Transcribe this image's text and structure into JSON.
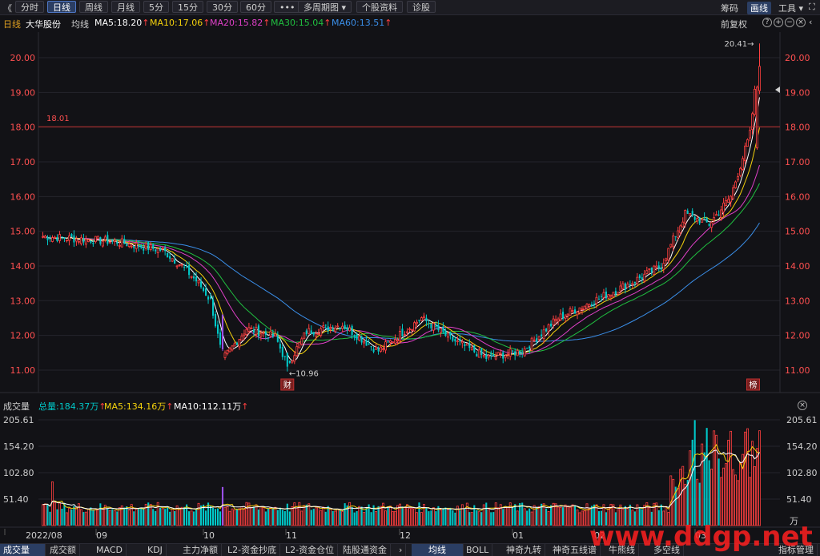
{
  "toolbar": {
    "back_label": "《",
    "periods": [
      "分时",
      "日线",
      "周线",
      "月线",
      "5分",
      "15分",
      "30分",
      "60分"
    ],
    "active_period": "日线",
    "more_label": "•••",
    "multi_period_label": "多周期图",
    "stock_info_label": "个股资料",
    "diagnose_label": "诊股",
    "right": {
      "chips_label": "筹码",
      "draw_label": "画线",
      "tools_label": "工具"
    }
  },
  "price_legend": {
    "period": "日线",
    "stock_name": "大华股份",
    "avg_label": "均线",
    "ma5": "MA5:18.20",
    "ma10": "MA10:17.06",
    "ma20": "MA20:15.82",
    "ma30": "MA30:15.04",
    "ma60": "MA60:13.51",
    "adjust_label": "前复权"
  },
  "volume_legend": {
    "title": "成交量",
    "total": "总量:184.37万",
    "ma5": "MA5:134.16万",
    "ma10": "MA10:112.11万"
  },
  "colors": {
    "up": "#ff4040",
    "down": "#00c8c8",
    "ma5": "#ffffff",
    "ma10": "#f5d20c",
    "ma20": "#e040c8",
    "ma30": "#20c040",
    "ma60": "#3a8ee8",
    "special": "#9a50e8",
    "bg": "#121216"
  },
  "chart_data": {
    "type": "candlestick",
    "price_ticks": [
      "20.00",
      "19.00",
      "18.00",
      "17.00",
      "16.00",
      "15.00",
      "14.00",
      "13.00",
      "12.00",
      "11.00"
    ],
    "volume_ticks": [
      "205.61",
      "154.20",
      "102.80",
      "51.40"
    ],
    "volume_unit": "万",
    "month_labels": [
      "2022/08",
      "09",
      "10",
      "11",
      "12",
      "01",
      "02",
      "03"
    ],
    "reference_line": {
      "value": 18.01,
      "label": "18.01"
    },
    "high_annotation": {
      "value": 20.41,
      "label": "20.41→"
    },
    "low_annotation": {
      "value": 10.96,
      "label": "←10.96"
    },
    "markers": [
      {
        "label": "财"
      },
      {
        "label": "榜"
      }
    ],
    "ylim": [
      10.7,
      20.9
    ],
    "candles_note": "OHLC values read approximately from chart",
    "key_points": [
      {
        "x": 0,
        "close": 14.85
      },
      {
        "x": 30,
        "close": 14.7
      },
      {
        "x": 50,
        "close": 14.45
      },
      {
        "x": 58,
        "close": 14.0
      },
      {
        "x": 65,
        "close": 13.5
      },
      {
        "x": 70,
        "close": 13.0
      },
      {
        "x": 75,
        "close": 11.3
      },
      {
        "x": 85,
        "close": 12.2
      },
      {
        "x": 97,
        "close": 11.95
      },
      {
        "x": 102,
        "close": 11.15
      },
      {
        "x": 110,
        "close": 12.1
      },
      {
        "x": 125,
        "close": 12.3
      },
      {
        "x": 140,
        "close": 11.55
      },
      {
        "x": 158,
        "close": 12.5
      },
      {
        "x": 170,
        "close": 11.9
      },
      {
        "x": 185,
        "close": 11.35
      },
      {
        "x": 200,
        "close": 11.55
      },
      {
        "x": 215,
        "close": 12.5
      },
      {
        "x": 230,
        "close": 13.0
      },
      {
        "x": 245,
        "close": 13.5
      },
      {
        "x": 258,
        "close": 14.0
      },
      {
        "x": 268,
        "close": 15.5
      },
      {
        "x": 278,
        "close": 15.2
      },
      {
        "x": 287,
        "close": 16.0
      },
      {
        "x": 295,
        "close": 17.8
      },
      {
        "x": 297,
        "close": 19.0
      },
      {
        "x": 299,
        "close": 19.75
      }
    ]
  },
  "bottom_tabs": [
    "成交量",
    "成交额",
    "MACD",
    "KDJ",
    "主力净额",
    "L2-资金抄底",
    "L2-资金仓位",
    "陆股通资金"
  ],
  "bottom_tabs_right": [
    "均线",
    "BOLL",
    "神奇九转",
    "神奇五线谱",
    "牛熊线",
    "多空线"
  ],
  "bottom_active": "均线",
  "indicator_manage_label": "指标管理",
  "watermark": "www.ddgp.net"
}
